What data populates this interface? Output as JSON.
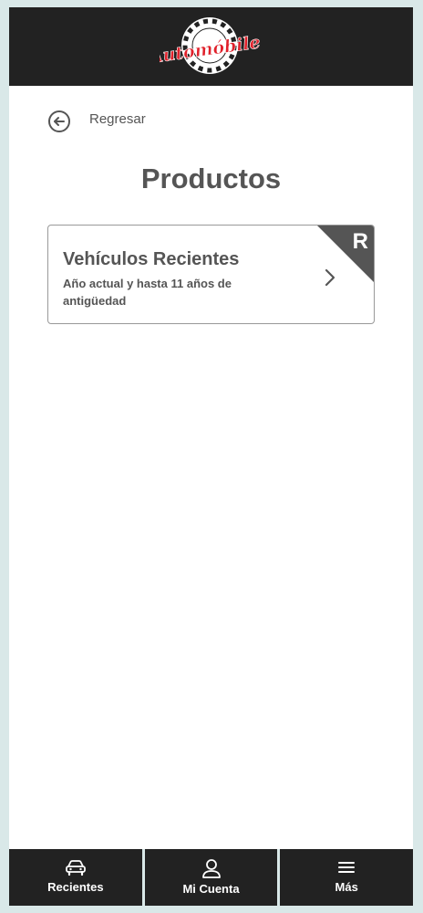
{
  "header": {
    "logo_text": "Automóbiles"
  },
  "navigation": {
    "back_label": "Regresar"
  },
  "page": {
    "title": "Productos"
  },
  "products": [
    {
      "title": "Vehículos Recientes",
      "description": "Año actual y hasta 11 años de antigüedad",
      "badge": "R",
      "icon": "chevron-right-icon"
    }
  ],
  "bottom_nav": [
    {
      "label": "Recientes",
      "icon": "car-icon"
    },
    {
      "label": "Mi Cuenta",
      "icon": "user-icon"
    },
    {
      "label": "Más",
      "icon": "menu-icon"
    }
  ],
  "colors": {
    "header_bg": "#222222",
    "text": "#555555",
    "logo_red": "#e0202a",
    "badge_bg": "#555555",
    "page_bg": "#d9e8e8"
  }
}
